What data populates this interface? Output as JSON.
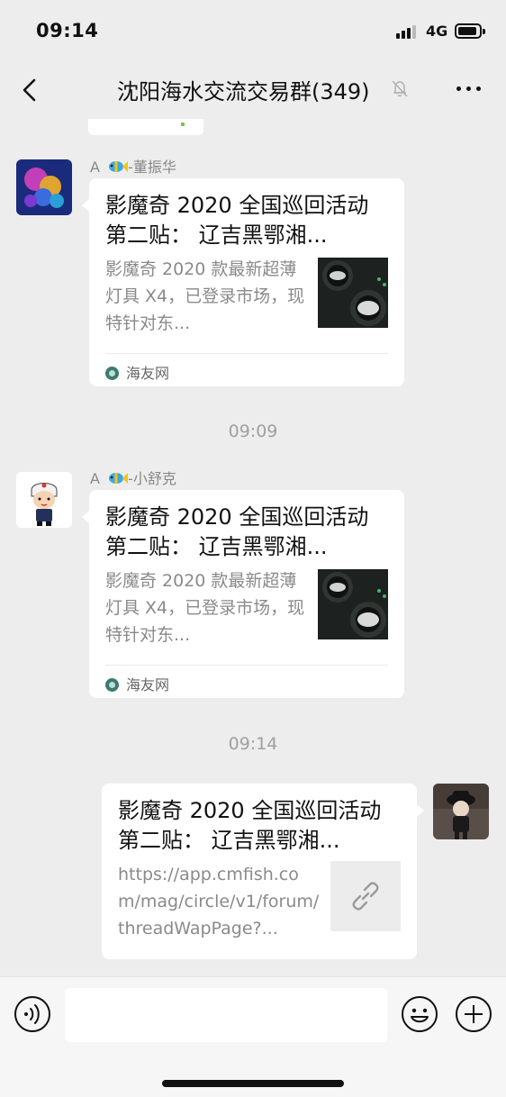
{
  "status_bar": {
    "time": "09:14",
    "network": "4G",
    "icons": [
      "signal-icon",
      "battery-icon"
    ]
  },
  "header": {
    "title": "沈阳海水交流交易群(349)",
    "back_icon": "chevron-left-icon",
    "mute_icon": "bell-slash-icon",
    "more_icon": "more-dots-icon"
  },
  "messages": [
    {
      "type": "article",
      "side": "left",
      "sender_prefix": "A",
      "sender_icon": "fish-emoji",
      "sender_suffix": "-董振华",
      "title": "影魔奇 2020 全国巡回活动第二贴： 辽吉黑鄂湘...",
      "description": "影魔奇 2020 款最新超薄灯具 X4，已登录市场，现特针对东...",
      "source": "海友网"
    },
    {
      "type": "timestamp",
      "text": "09:09"
    },
    {
      "type": "article",
      "side": "left",
      "sender_prefix": "A",
      "sender_icon": "fish-emoji",
      "sender_suffix": "-小舒克",
      "title": "影魔奇 2020 全国巡回活动第二贴： 辽吉黑鄂湘...",
      "description": "影魔奇 2020 款最新超薄灯具 X4，已登录市场，现特针对东...",
      "source": "海友网"
    },
    {
      "type": "timestamp",
      "text": "09:14"
    },
    {
      "type": "link",
      "side": "right",
      "title": "影魔奇 2020 全国巡回活动第二贴： 辽吉黑鄂湘...",
      "description": "https://app.cmfish.com/mag/circle/v1/forum/threadWapPage?...",
      "thumb_icon": "link-icon"
    }
  ],
  "input_bar": {
    "value": "",
    "placeholder": "",
    "icons": [
      "voice-icon",
      "emoji-icon",
      "plus-icon"
    ]
  },
  "colors": {
    "background": "#ededed",
    "bubble": "#ffffff",
    "secondary_text": "#8a8a8a",
    "timestamp": "#a0a0a0"
  }
}
